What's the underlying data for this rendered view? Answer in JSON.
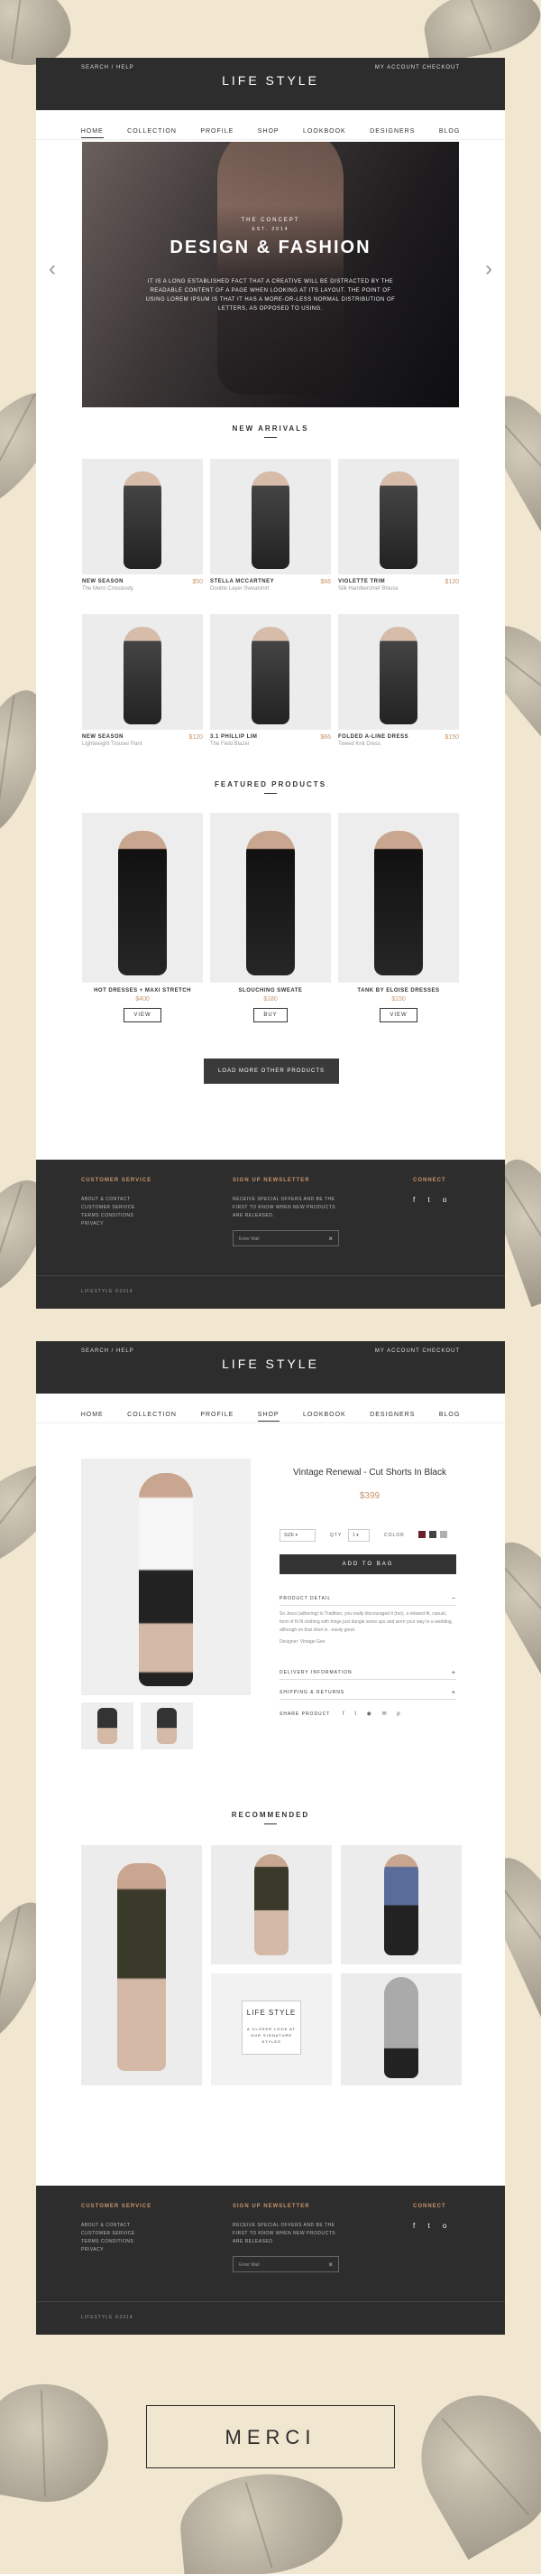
{
  "brand": "LIFE STYLE",
  "topbar": {
    "left": "SEARCH  /  HELP",
    "right": "MY ACCOUNT    CHECKOUT"
  },
  "nav": [
    "HOME",
    "COLLECTION",
    "PROFILE",
    "SHOP",
    "LOOKBOOK",
    "DESIGNERS",
    "BLOG"
  ],
  "hero": {
    "eyebrow": "THE CONCEPT",
    "est": "EST. 2014",
    "title": "DESIGN & FASHION",
    "desc": "IT IS A LONG ESTABLISHED FACT THAT A CREATIVE WILL BE DISTRACTED BY THE READABLE CONTENT OF A PAGE WHEN LOOKING AT ITS LAYOUT. THE POINT OF USING LOREM IPSUM IS THAT IT HAS A MORE-OR-LESS NORMAL DISTRIBUTION OF LETTERS, AS OPPOSED TO USING."
  },
  "new_arrivals": {
    "title": "NEW ARRIVALS",
    "items": [
      {
        "name": "NEW SEASON",
        "sub": "The Merci Crossbody",
        "price": "$50"
      },
      {
        "name": "STELLA MCCARTNEY",
        "sub": "Double Layer Sweatshirt",
        "price": "$66"
      },
      {
        "name": "VIOLETTE TRIM",
        "sub": "Silk Handkerchief Blouse",
        "price": "$120"
      },
      {
        "name": "NEW SEASON",
        "sub": "Lightweight Trouser Pant",
        "price": "$120"
      },
      {
        "name": "3.1 PHILLIP LIM",
        "sub": "The Field Blazer",
        "price": "$66"
      },
      {
        "name": "FOLDED A-LINE DRESS",
        "sub": "Tweed Knit Dress",
        "price": "$150"
      }
    ]
  },
  "featured": {
    "title": "FEATURED PRODUCTS",
    "items": [
      {
        "name": "HOT DRESSES + MAXI STRETCH",
        "price": "$400",
        "button": "VIEW"
      },
      {
        "name": "SLOUCHING SWEATE",
        "price": "$180",
        "button": "BUY"
      },
      {
        "name": "TANK BY ELOISE DRESSES",
        "price": "$150",
        "button": "VIEW"
      }
    ],
    "load_more": "LOAD MORE OTHER PRODUCTS"
  },
  "footer": {
    "customer_service_title": "CUSTOMER SERVICE",
    "customer_service_links": [
      "ABOUT & CONTACT",
      "CUSTOMER SERVICE",
      "TERMS CONDITIONS",
      "PRIVACY"
    ],
    "newsletter_title_1": "SIGN UP NEWSLETTER",
    "newsletter_title_2": "SIGN UP NEWSLETTER",
    "newsletter_text": "RECEIVE SPECIAL OFFERS AND BE THE FIRST TO KNOW WHEN NEW PRODUCTS ARE RELEASED.",
    "email_placeholder": "Enter Mail",
    "connect_title": "CONNECT",
    "social": "f  t  o",
    "copyright": "LIFESTYLE ©2014"
  },
  "product": {
    "title": "Vintage Renewal - Cut Shorts In Black",
    "price": "$399",
    "size_label": "SIZE",
    "qty_label": "QTY",
    "qty_value": "1",
    "color_label": "COLOR",
    "colors": [
      "#6b1f2b",
      "#444444",
      "#b0b0b0"
    ],
    "add_to_bag": "ADD TO BAG",
    "detail_title": "PRODUCT DETAIL",
    "detail_text": "So Jessi (adhering) to Tradition, you really discouraged it (too), a relaxed-fit, casual, form of fit fit clothing with fringe just dangle some ups and worn your way to a wedding, although on that short is . easily  good.",
    "detail_designer": "Designer: Vintage Gen",
    "delivery": "DELIVERY INFORMATION",
    "shipping": "SHIPPING & RETURNS",
    "share": "SHARE PRODUCT"
  },
  "recommended": {
    "title": "RECOMMENDED",
    "promo_title": "LIFE STYLE",
    "promo_text": "A CLOSER LOOK AT OUR SIGNATURE STYLES"
  },
  "merci": "MERCI"
}
